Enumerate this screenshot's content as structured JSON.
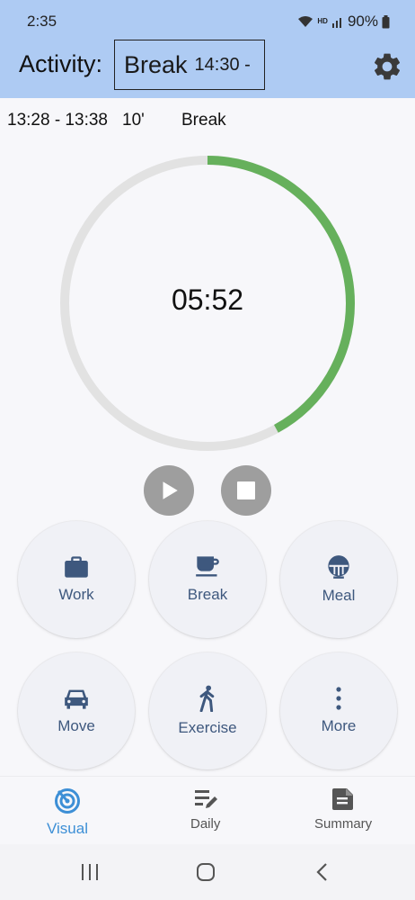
{
  "status_bar": {
    "time": "2:35",
    "battery": "90%",
    "network_label": "HD"
  },
  "header": {
    "activity_label": "Activity:",
    "current_activity": "Break",
    "current_start": "14:30 -",
    "settings_icon": "gear-icon"
  },
  "last_entry": {
    "range": "13:28 - 13:38",
    "duration": "10'",
    "name": "Break"
  },
  "timer": {
    "display": "05:52",
    "progress": 0.42,
    "progress_color": "#66b05c",
    "track_color": "#e2e2e2"
  },
  "controls": {
    "play_icon": "play-icon",
    "stop_icon": "stop-icon"
  },
  "activities": [
    {
      "label": "Work",
      "icon": "briefcase-icon"
    },
    {
      "label": "Break",
      "icon": "coffee-cup-icon"
    },
    {
      "label": "Meal",
      "icon": "rice-bowl-icon"
    },
    {
      "label": "Move",
      "icon": "car-icon"
    },
    {
      "label": "Exercise",
      "icon": "walking-person-icon"
    },
    {
      "label": "More",
      "icon": "more-vertical-icon"
    }
  ],
  "bottom_nav": [
    {
      "label": "Visual",
      "icon": "radar-icon",
      "active": true
    },
    {
      "label": "Daily",
      "icon": "edit-list-icon",
      "active": false
    },
    {
      "label": "Summary",
      "icon": "summary-doc-icon",
      "active": false
    }
  ],
  "accent_color": "#3d8fd6",
  "header_color": "#aecbf3"
}
